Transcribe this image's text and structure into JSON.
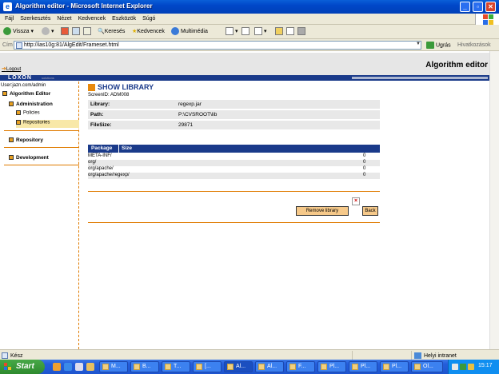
{
  "window": {
    "title": "Algorithm editor - Microsoft Internet Explorer"
  },
  "menu": [
    "Fájl",
    "Szerkesztés",
    "Nézet",
    "Kedvencek",
    "Eszközök",
    "Súgó"
  ],
  "toolbar": {
    "back": "Vissza",
    "search": "Keresés",
    "favorites": "Kedvencek",
    "media": "Multimédia"
  },
  "address": {
    "label": "Cím",
    "url": "http://ias10g:81/AlgEdit/Frameset.html",
    "go": "Ugrás",
    "links": "Hivatkozások"
  },
  "page": {
    "logout": "Logout",
    "app_title": "Algorithm editor",
    "logo": "LOXON",
    "logo_sub": "solutions",
    "user": "User:jazn.com/admin"
  },
  "sidebar": {
    "root": "Algorithm Editor",
    "administration": "Administration",
    "policies": "Policies",
    "repositories": "Repositories",
    "repository": "Repository",
    "development": "Development"
  },
  "main": {
    "title": "SHOW LIBRARY",
    "screen_id": "ScreenID: ADM008",
    "fields": [
      {
        "key": "Library:",
        "value": "regexp.jar"
      },
      {
        "key": "Path:",
        "value": "P:\\CVSROOT\\lib"
      },
      {
        "key": "FileSize:",
        "value": "29871"
      }
    ],
    "table": {
      "headers": [
        "Package",
        "Size"
      ],
      "rows": [
        {
          "package": "META-INF/",
          "size": "0"
        },
        {
          "package": "org/",
          "size": "0"
        },
        {
          "package": "org/apache/",
          "size": "0"
        },
        {
          "package": "org/apache/regexp/",
          "size": "0"
        }
      ]
    },
    "remove_button": "Remove library",
    "back_button": "Back"
  },
  "status": {
    "left": "Kész",
    "zone": "Helyi intranet"
  },
  "taskbar": {
    "start": "Start",
    "tasks": [
      "M...",
      "B...",
      "T...",
      "[...",
      "Al...",
      "Al...",
      "F...",
      "Pl...",
      "Pl...",
      "Pl...",
      "Ol..."
    ],
    "clock": "15:17"
  }
}
